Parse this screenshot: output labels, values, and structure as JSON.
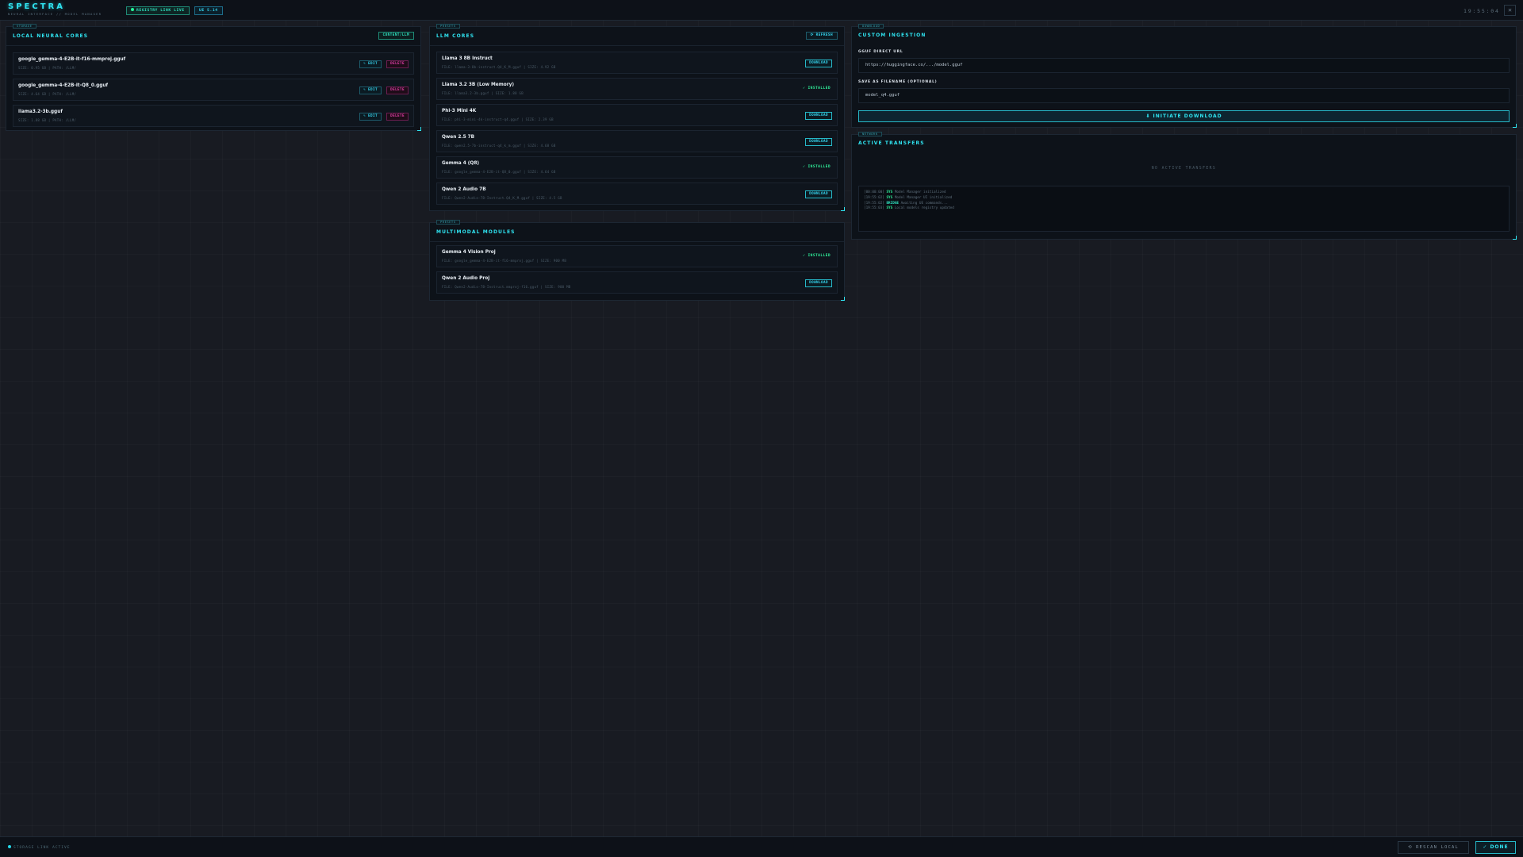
{
  "header": {
    "title": "SPECTRA",
    "subtitle": "NEURAL INTERFACE // MODEL MANAGER",
    "registry_status": "REGISTRY LINK LIVE",
    "version": "UE 5.14",
    "clock": "19:55:04",
    "close_glyph": "✕"
  },
  "local": {
    "tag": "STORAGE",
    "title": "LOCAL NEURAL CORES",
    "filter": "CONTENT/LLM",
    "edit_label": "✎ EDIT",
    "delete_label": "DELETE",
    "items": [
      {
        "name": "google_gemma-4-E2B-it-f16-mmproj.gguf",
        "meta": "SIZE: 0.95 GB | PATH: /LLM/"
      },
      {
        "name": "google_gemma-4-E2B-it-Q8_0.gguf",
        "meta": "SIZE: 4.64 GB | PATH: /LLM/"
      },
      {
        "name": "llama3.2-3b.gguf",
        "meta": "SIZE: 1.88 GB | PATH: /LLM/"
      }
    ]
  },
  "llm": {
    "tag": "PRESETS",
    "title": "LLM CORES",
    "refresh_label": "⟳ REFRESH",
    "download_label": "DOWNLOAD",
    "installed_label": "✓ INSTALLED",
    "items": [
      {
        "name": "Llama 3 8B Instruct",
        "meta": "FILE: llama-3-8b-instruct.Q4_K_M.gguf | SIZE: 4.92 GB",
        "status": "download"
      },
      {
        "name": "Llama 3.2 3B (Low Memory)",
        "meta": "FILE: llama3.2-3b.gguf | SIZE: 1.88 GB",
        "status": "installed"
      },
      {
        "name": "Phi-3 Mini 4K",
        "meta": "FILE: phi-3-mini-4k-instruct-q4.gguf | SIZE: 2.39 GB",
        "status": "download"
      },
      {
        "name": "Qwen 2.5 7B",
        "meta": "FILE: qwen2.5-7b-instruct-q4_k_m.gguf | SIZE: 4.68 GB",
        "status": "download"
      },
      {
        "name": "Gemma 4 (Q8)",
        "meta": "FILE: google_gemma-4-E2B-it-Q8_0.gguf | SIZE: 4.64 GB",
        "status": "installed"
      },
      {
        "name": "Qwen 2 Audio 7B",
        "meta": "FILE: Qwen2-Audio-7B-Instruct.Q4_K_M.gguf | SIZE: 4.5 GB",
        "status": "download"
      }
    ]
  },
  "multimodal": {
    "tag": "PRESETS",
    "title": "MULTIMODAL MODULES",
    "items": [
      {
        "name": "Gemma 4 Vision Proj",
        "meta": "FILE: google_gemma-4-E2B-it-f16-mmproj.gguf | SIZE: 900 MB",
        "status": "installed"
      },
      {
        "name": "Qwen 2 Audio Proj",
        "meta": "FILE: Qwen2-Audio-7B-Instruct.mmproj-f16.gguf | SIZE: 900 MB",
        "status": "download"
      }
    ]
  },
  "ingest": {
    "tag": "DOWNLOAD",
    "title": "CUSTOM INGESTION",
    "url_label": "GGUF DIRECT URL",
    "url_placeholder": "https://huggingface.co/.../model.gguf",
    "filename_label": "SAVE AS FILENAME (OPTIONAL)",
    "filename_placeholder": "model_q4.gguf",
    "initiate_label": "⬇ INITIATE DOWNLOAD"
  },
  "transfers": {
    "tag": "NETWORK",
    "title": "ACTIVE TRANSFERS",
    "empty": "NO ACTIVE TRANSFERS",
    "log": [
      {
        "time": "[00:00:00]",
        "tag": "SYS",
        "msg": "Model Manager initialized"
      },
      {
        "time": "[19:55:02]",
        "tag": "SYS",
        "msg": "Model Manager UI initialized"
      },
      {
        "time": "[19:55:02]",
        "tag": "BRIDGE",
        "msg": "Awaiting UE commands..."
      },
      {
        "time": "[19:55:03]",
        "tag": "SYS",
        "msg": "Local models registry updated"
      }
    ]
  },
  "footer": {
    "storage": "STORAGE LINK ACTIVE",
    "rescan": "⟲ RESCAN LOCAL",
    "done": "✓ DONE"
  },
  "colors": {
    "accent": "#2fe3f0",
    "success": "#2ff09a",
    "danger": "#e23ea8",
    "background": "#181b22"
  }
}
